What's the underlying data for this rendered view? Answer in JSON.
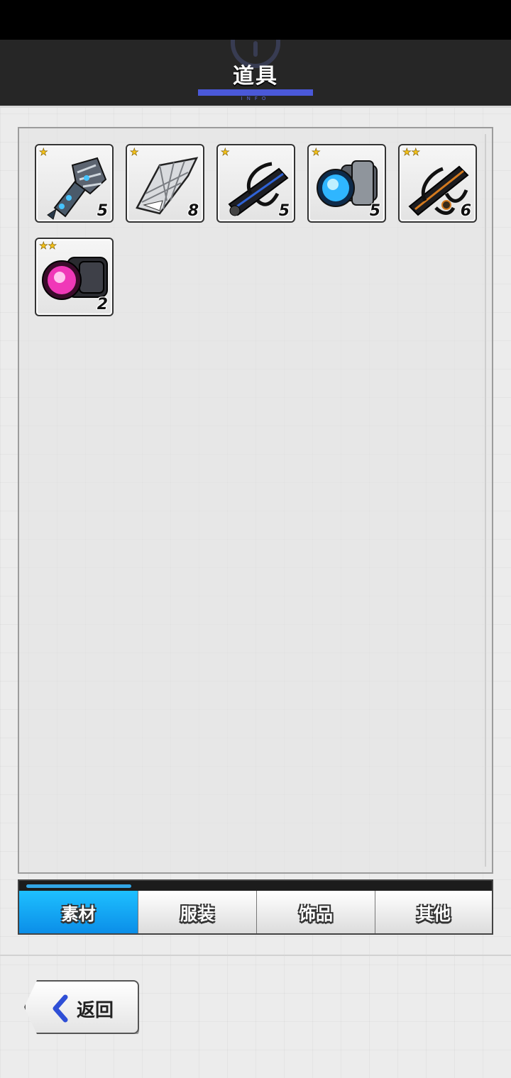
{
  "header": {
    "title": "道具",
    "subtitle": "INFO"
  },
  "items": [
    {
      "name": "spiked-armor-part",
      "stars": "★",
      "count": "5",
      "rarity_color": "#3aa6e8"
    },
    {
      "name": "silver-frame-part",
      "stars": "★",
      "count": "8",
      "rarity_color": "#9a9a9a"
    },
    {
      "name": "blue-cable-part",
      "stars": "★",
      "count": "5",
      "rarity_color": "#2f63d6"
    },
    {
      "name": "blue-lamp-part",
      "stars": "★",
      "count": "5",
      "rarity_color": "#27a4f4"
    },
    {
      "name": "orange-cable-part",
      "stars": "★★",
      "count": "6",
      "rarity_color": "#d47a1e"
    },
    {
      "name": "pink-lamp-part",
      "stars": "★★",
      "count": "2",
      "rarity_color": "#f038b8"
    }
  ],
  "tabs": [
    {
      "label": "素材",
      "active": true
    },
    {
      "label": "服装",
      "active": false
    },
    {
      "label": "饰品",
      "active": false
    },
    {
      "label": "其他",
      "active": false
    }
  ],
  "back_button": {
    "label": "返回"
  }
}
